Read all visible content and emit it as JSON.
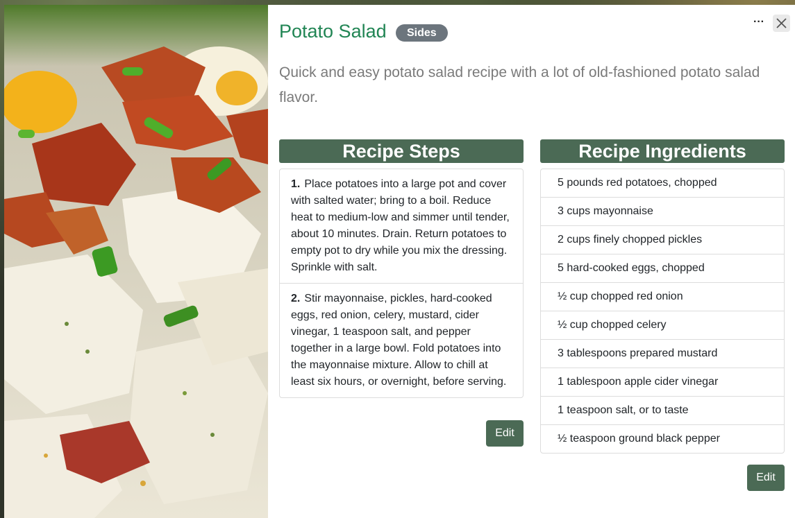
{
  "recipe": {
    "title": "Potato Salad",
    "category": "Sides",
    "description": "Quick and easy potato salad recipe with a lot of old-fashioned potato salad flavor."
  },
  "controls": {
    "more_label": "···",
    "close_icon": "close-icon",
    "more_icon": "ellipsis-icon"
  },
  "steps_section": {
    "heading": "Recipe Steps",
    "edit_label": "Edit",
    "steps": [
      {
        "number": "1.",
        "text": "Place potatoes into a large pot and cover with salted water; bring to a boil. Reduce heat to medium-low and simmer until tender, about 10 minutes. Drain. Return potatoes to empty pot to dry while you mix the dressing. Sprinkle with salt."
      },
      {
        "number": "2.",
        "text": "Stir mayonnaise, pickles, hard-cooked eggs, red onion, celery, mustard, cider vinegar, 1 teaspoon salt, and pepper together in a large bowl. Fold potatoes into the mayonnaise mixture. Allow to chill at least six hours, or overnight, before serving."
      }
    ]
  },
  "ingredients_section": {
    "heading": "Recipe Ingredients",
    "edit_label": "Edit",
    "items": [
      "5 pounds red potatoes, chopped",
      "3 cups mayonnaise",
      "2 cups finely chopped pickles",
      "5 hard-cooked eggs, chopped",
      "½ cup chopped red onion",
      "½ cup chopped celery",
      "3 tablespoons prepared mustard",
      "1 tablespoon apple cider vinegar",
      "1 teaspoon salt, or to taste",
      "½ teaspoon ground black pepper"
    ]
  },
  "colors": {
    "title": "#218554",
    "header_bg": "#4b6a55",
    "badge_bg": "#6c757d",
    "description": "#7a7a7a"
  }
}
